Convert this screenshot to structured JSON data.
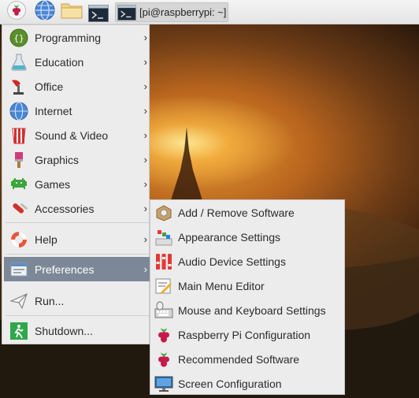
{
  "taskbar": {
    "launchers": [
      {
        "icon": "raspberry-icon",
        "color": "#c51a4a"
      },
      {
        "icon": "globe-icon",
        "color": "#3b73c8"
      },
      {
        "icon": "folder-icon",
        "color": "#e8c26a"
      },
      {
        "icon": "terminal-icon",
        "color": "#1d2a3a"
      }
    ],
    "window_title": "[pi@raspberrypi: ~]"
  },
  "main_menu": {
    "items": [
      {
        "label": "Programming",
        "icon": "programming-icon",
        "arrow": "›"
      },
      {
        "label": "Education",
        "icon": "education-flask-icon",
        "arrow": "›"
      },
      {
        "label": "Office",
        "icon": "office-icon",
        "arrow": "›"
      },
      {
        "label": "Internet",
        "icon": "globe-icon",
        "arrow": "›"
      },
      {
        "label": "Sound & Video",
        "icon": "sound-video-icon",
        "arrow": "›"
      },
      {
        "label": "Graphics",
        "icon": "paintbrush-icon",
        "arrow": "›"
      },
      {
        "label": "Games",
        "icon": "space-invader-icon",
        "arrow": "›"
      },
      {
        "label": "Accessories",
        "icon": "accessories-knife-icon",
        "arrow": "›"
      },
      {
        "label": "Help",
        "icon": "lifebuoy-icon",
        "arrow": "›"
      },
      {
        "label": "Preferences",
        "icon": "preferences-icon",
        "arrow": "›",
        "selected": true
      },
      {
        "label": "Run...",
        "icon": "paper-plane-icon"
      },
      {
        "label": "Shutdown...",
        "icon": "shutdown-exit-icon"
      }
    ],
    "selected_color": "#7c8897"
  },
  "preferences_menu": {
    "items": [
      {
        "label": "Add / Remove Software",
        "icon": "package-icon"
      },
      {
        "label": "Appearance Settings",
        "icon": "appearance-icon"
      },
      {
        "label": "Audio Device Settings",
        "icon": "audio-mixer-icon"
      },
      {
        "label": "Main Menu Editor",
        "icon": "menu-editor-icon"
      },
      {
        "label": "Mouse and Keyboard Settings",
        "icon": "keyboard-mouse-icon"
      },
      {
        "label": "Raspberry Pi Configuration",
        "icon": "raspberry-icon"
      },
      {
        "label": "Recommended Software",
        "icon": "raspberry-icon"
      },
      {
        "label": "Screen Configuration",
        "icon": "monitor-icon"
      }
    ]
  }
}
